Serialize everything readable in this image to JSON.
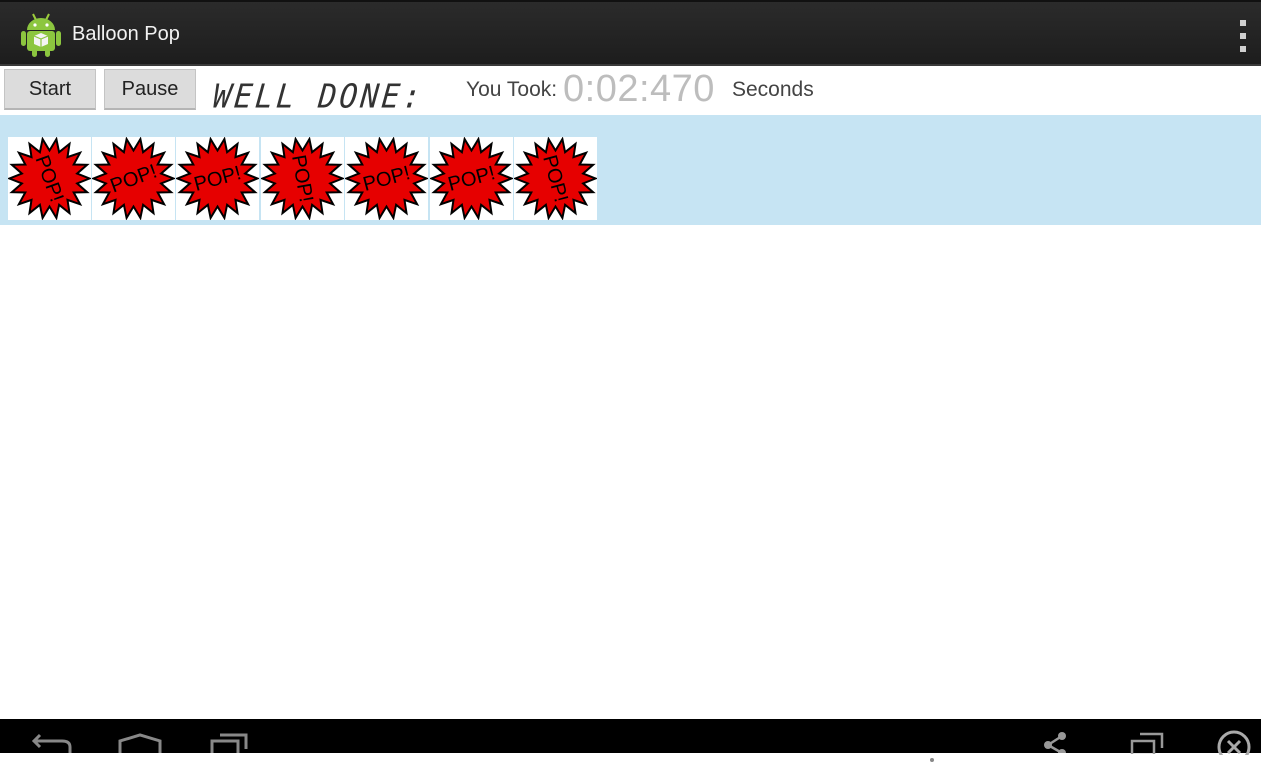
{
  "app": {
    "title": "Balloon Pop",
    "icon": "android-icon"
  },
  "controls": {
    "start_label": "Start",
    "pause_label": "Pause",
    "status_text": "WELL DONE:",
    "took_label": "You Took:",
    "took_value": "0:02:470",
    "seconds_label": "Seconds"
  },
  "balloons": {
    "label": "POP!",
    "count": 7,
    "fill_color": "#e60000",
    "row_background": "#c6e4f3"
  },
  "nav": {
    "back": "back-icon",
    "home": "home-icon",
    "recents": "recents-icon",
    "share": "share-icon",
    "window": "window-icon",
    "close": "close-icon"
  }
}
